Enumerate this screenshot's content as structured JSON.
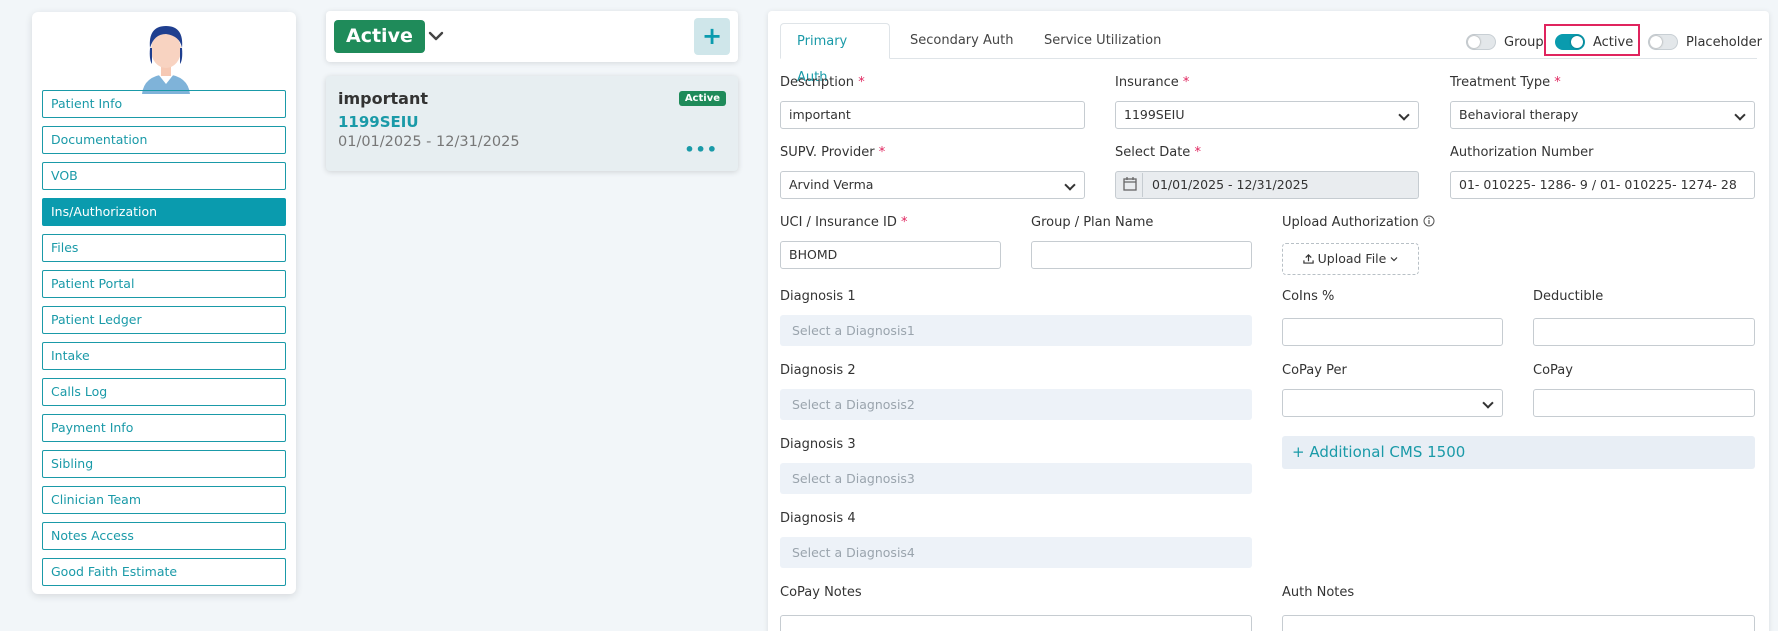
{
  "sidebar": {
    "items": [
      {
        "label": "Patient Info",
        "active": false
      },
      {
        "label": "Documentation",
        "active": false
      },
      {
        "label": "VOB",
        "active": false
      },
      {
        "label": "Ins/Authorization",
        "active": true
      },
      {
        "label": "Files",
        "active": false
      },
      {
        "label": "Patient Portal",
        "active": false
      },
      {
        "label": "Patient Ledger",
        "active": false
      },
      {
        "label": "Intake",
        "active": false
      },
      {
        "label": "Calls Log",
        "active": false
      },
      {
        "label": "Payment Info",
        "active": false
      },
      {
        "label": "Sibling",
        "active": false
      },
      {
        "label": "Clinician Team",
        "active": false
      },
      {
        "label": "Notes Access",
        "active": false
      },
      {
        "label": "Good Faith Estimate",
        "active": false
      }
    ]
  },
  "auth_list": {
    "status_filter": "Active",
    "add_label": "+",
    "card": {
      "title": "important",
      "badge": "Active",
      "insurance": "1199SEIU",
      "dates": "01/01/2025 - 12/31/2025",
      "more": "•••"
    }
  },
  "tabs": [
    "Primary Auth",
    "Secondary Auth",
    "Service Utilization"
  ],
  "toggles": [
    {
      "label": "Group",
      "on": false
    },
    {
      "label": "Active",
      "on": true
    },
    {
      "label": "Placeholder",
      "on": false
    }
  ],
  "form": {
    "description": {
      "label": "Description",
      "value": "important"
    },
    "insurance": {
      "label": "Insurance",
      "value": "1199SEIU"
    },
    "treatment_type": {
      "label": "Treatment Type",
      "value": "Behavioral therapy"
    },
    "supv_provider": {
      "label": "SUPV. Provider",
      "value": "Arvind Verma"
    },
    "select_date": {
      "label": "Select Date",
      "value": "01/01/2025 - 12/31/2025"
    },
    "auth_number": {
      "label": "Authorization Number",
      "value": "01- 010225- 1286- 9 / 01- 010225- 1274- 28"
    },
    "uci": {
      "label": "UCI / Insurance ID",
      "value": "BHOMD"
    },
    "group_plan": {
      "label": "Group / Plan Name",
      "value": ""
    },
    "upload": {
      "label": "Upload Authorization",
      "button": "Upload File"
    },
    "diagnosis1": {
      "label": "Diagnosis 1",
      "placeholder": "Select a Diagnosis1"
    },
    "diagnosis2": {
      "label": "Diagnosis 2",
      "placeholder": "Select a Diagnosis2"
    },
    "diagnosis3": {
      "label": "Diagnosis 3",
      "placeholder": "Select a Diagnosis3"
    },
    "diagnosis4": {
      "label": "Diagnosis 4",
      "placeholder": "Select a Diagnosis4"
    },
    "coins": {
      "label": "CoIns %",
      "value": ""
    },
    "deductible": {
      "label": "Deductible",
      "value": ""
    },
    "copay_per": {
      "label": "CoPay Per",
      "value": ""
    },
    "copay": {
      "label": "CoPay",
      "value": ""
    },
    "additional_cms": "+ Additional CMS 1500",
    "copay_notes": {
      "label": "CoPay Notes"
    },
    "auth_notes": {
      "label": "Auth Notes"
    }
  },
  "colors": {
    "accent": "#0a9bae",
    "active_green": "#1f8b5a",
    "required": "#e0245e"
  }
}
